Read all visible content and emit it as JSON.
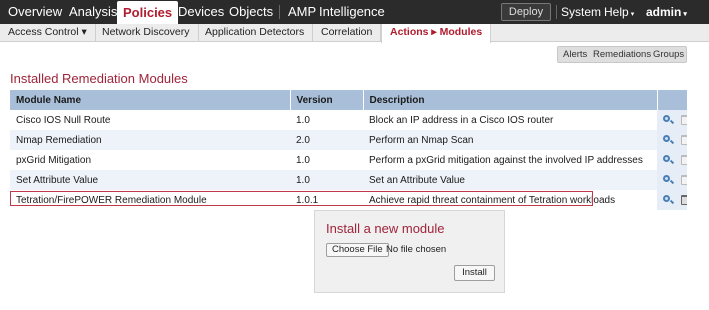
{
  "topnav": {
    "items": [
      "Overview",
      "Analysis",
      "Policies",
      "Devices",
      "Objects",
      "AMP",
      "Intelligence"
    ],
    "deploy_label": "Deploy",
    "system_label": "System",
    "help_label": "Help",
    "user_label": "admin",
    "caret": "▾"
  },
  "subnav": {
    "items": [
      "Access Control ▾",
      "Network Discovery",
      "Application Detectors",
      "Correlation",
      "Actions ▸ Modules"
    ]
  },
  "right_tabs": [
    "Alerts",
    "Remediations",
    "Groups"
  ],
  "page_title": "Installed Remediation Modules",
  "table": {
    "headers": [
      "Module Name",
      "Version",
      "Description"
    ],
    "rows": [
      {
        "name": "Cisco IOS Null Route",
        "version": "1.0",
        "description": "Block an IP address in a Cisco IOS router"
      },
      {
        "name": "Nmap Remediation",
        "version": "2.0",
        "description": "Perform an Nmap Scan"
      },
      {
        "name": "pxGrid Mitigation",
        "version": "1.0",
        "description": "Perform a pxGrid mitigation against the involved IP addresses"
      },
      {
        "name": "Set Attribute Value",
        "version": "1.0",
        "description": "Set an Attribute Value"
      },
      {
        "name": "Tetration/FirePOWER Remediation Module",
        "version": "1.0.1",
        "description": "Achieve rapid threat containment of Tetration workloads"
      }
    ]
  },
  "install": {
    "title": "Install a new module",
    "choose_file_label": "Choose File",
    "no_file_text": "No file chosen",
    "install_label": "Install"
  },
  "colors": {
    "brand_red": "#b01d2f",
    "header_bg": "#2b2b2b",
    "table_header_bg": "#a9bfd9"
  }
}
